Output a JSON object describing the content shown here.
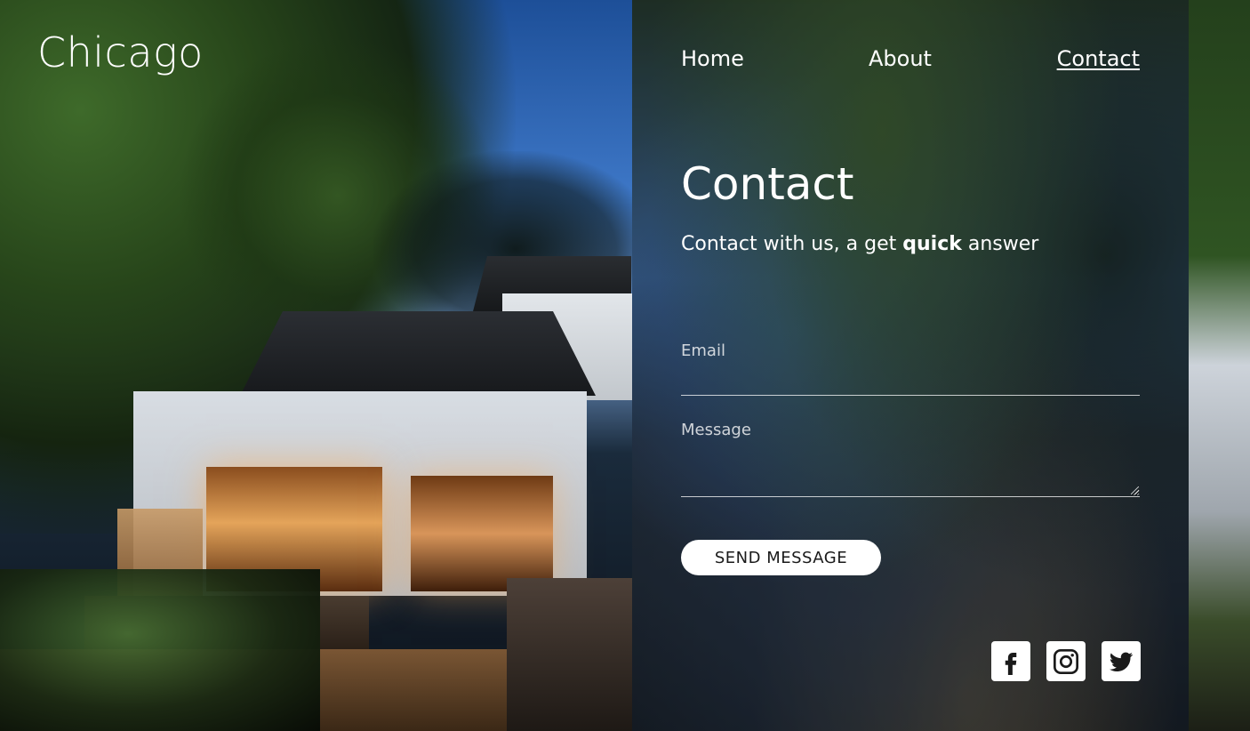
{
  "header": {
    "logo": "Chicago",
    "nav": [
      {
        "label": "Home",
        "active": false
      },
      {
        "label": "About",
        "active": false
      },
      {
        "label": "Contact",
        "active": true
      }
    ]
  },
  "contact": {
    "title": "Contact",
    "subtitle_before": "Contact with us, a get ",
    "subtitle_bold": "quick",
    "subtitle_after": " answer",
    "email_label": "Email",
    "email_value": "",
    "message_label": "Message",
    "message_value": "",
    "send_label": "SEND MESSAGE"
  },
  "social": [
    {
      "icon": "facebook-icon"
    },
    {
      "icon": "instagram-icon"
    },
    {
      "icon": "twitter-icon"
    }
  ],
  "colors": {
    "text": "#ffffff",
    "button_bg": "#ffffff",
    "button_text": "#1a1a1a"
  }
}
